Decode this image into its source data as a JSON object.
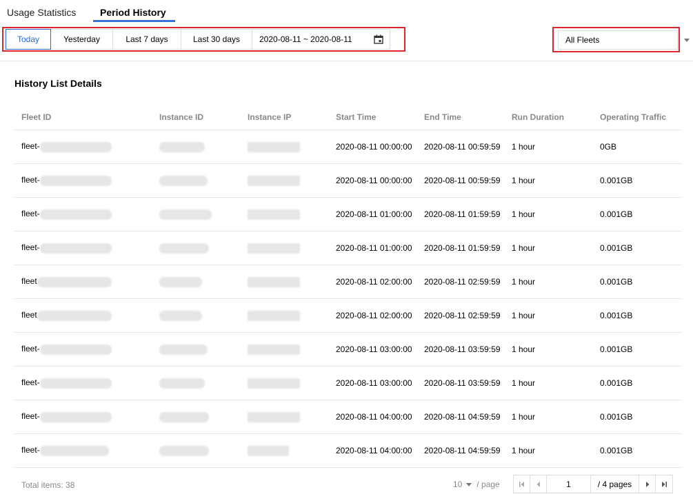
{
  "tabs": [
    {
      "label": "Usage Statistics",
      "active": false
    },
    {
      "label": "Period History",
      "active": true
    }
  ],
  "filters": {
    "buttons": [
      "Today",
      "Yesterday",
      "Last 7 days",
      "Last 30 days"
    ],
    "active_index": 0,
    "date_range": "2020-08-11 ~ 2020-08-11",
    "fleet_select": "All Fleets"
  },
  "section_title": "History List Details",
  "table": {
    "columns": [
      "Fleet ID",
      "Instance ID",
      "Instance IP",
      "Start Time",
      "End Time",
      "Run Duration",
      "Operating Traffic"
    ],
    "rows": [
      {
        "fleet_id": "fleet-",
        "start": "2020-08-11 00:00:00",
        "end": "2020-08-11 00:59:59",
        "duration": "1 hour",
        "traffic": "0GB"
      },
      {
        "fleet_id": "fleet-",
        "start": "2020-08-11 00:00:00",
        "end": "2020-08-11 00:59:59",
        "duration": "1 hour",
        "traffic": "0.001GB"
      },
      {
        "fleet_id": "fleet-",
        "start": "2020-08-11 01:00:00",
        "end": "2020-08-11 01:59:59",
        "duration": "1 hour",
        "traffic": "0.001GB"
      },
      {
        "fleet_id": "fleet-",
        "start": "2020-08-11 01:00:00",
        "end": "2020-08-11 01:59:59",
        "duration": "1 hour",
        "traffic": "0.001GB"
      },
      {
        "fleet_id": "fleet",
        "start": "2020-08-11 02:00:00",
        "end": "2020-08-11 02:59:59",
        "duration": "1 hour",
        "traffic": "0.001GB"
      },
      {
        "fleet_id": "fleet",
        "start": "2020-08-11 02:00:00",
        "end": "2020-08-11 02:59:59",
        "duration": "1 hour",
        "traffic": "0.001GB"
      },
      {
        "fleet_id": "fleet-",
        "start": "2020-08-11 03:00:00",
        "end": "2020-08-11 03:59:59",
        "duration": "1 hour",
        "traffic": "0.001GB"
      },
      {
        "fleet_id": "fleet-",
        "start": "2020-08-11 03:00:00",
        "end": "2020-08-11 03:59:59",
        "duration": "1 hour",
        "traffic": "0.001GB"
      },
      {
        "fleet_id": "fleet-",
        "start": "2020-08-11 04:00:00",
        "end": "2020-08-11 04:59:59",
        "duration": "1 hour",
        "traffic": "0.001GB"
      },
      {
        "fleet_id": "fleet-",
        "start": "2020-08-11 04:00:00",
        "end": "2020-08-11 04:59:59",
        "duration": "1 hour",
        "traffic": "0.001GB"
      }
    ]
  },
  "footer": {
    "total_label": "Total items:",
    "total_count": "38",
    "page_size": "10",
    "page_size_suffix": "/ page",
    "current_page": "1",
    "pages_text": "/ 4 pages"
  },
  "icons": {
    "calendar": "calendar-icon",
    "first": "first-page-icon",
    "prev": "prev-page-icon",
    "next": "next-page-icon",
    "last": "last-page-icon"
  },
  "colors": {
    "accent": "#2667d1",
    "highlight": "#e1242b",
    "muted": "#888888"
  }
}
